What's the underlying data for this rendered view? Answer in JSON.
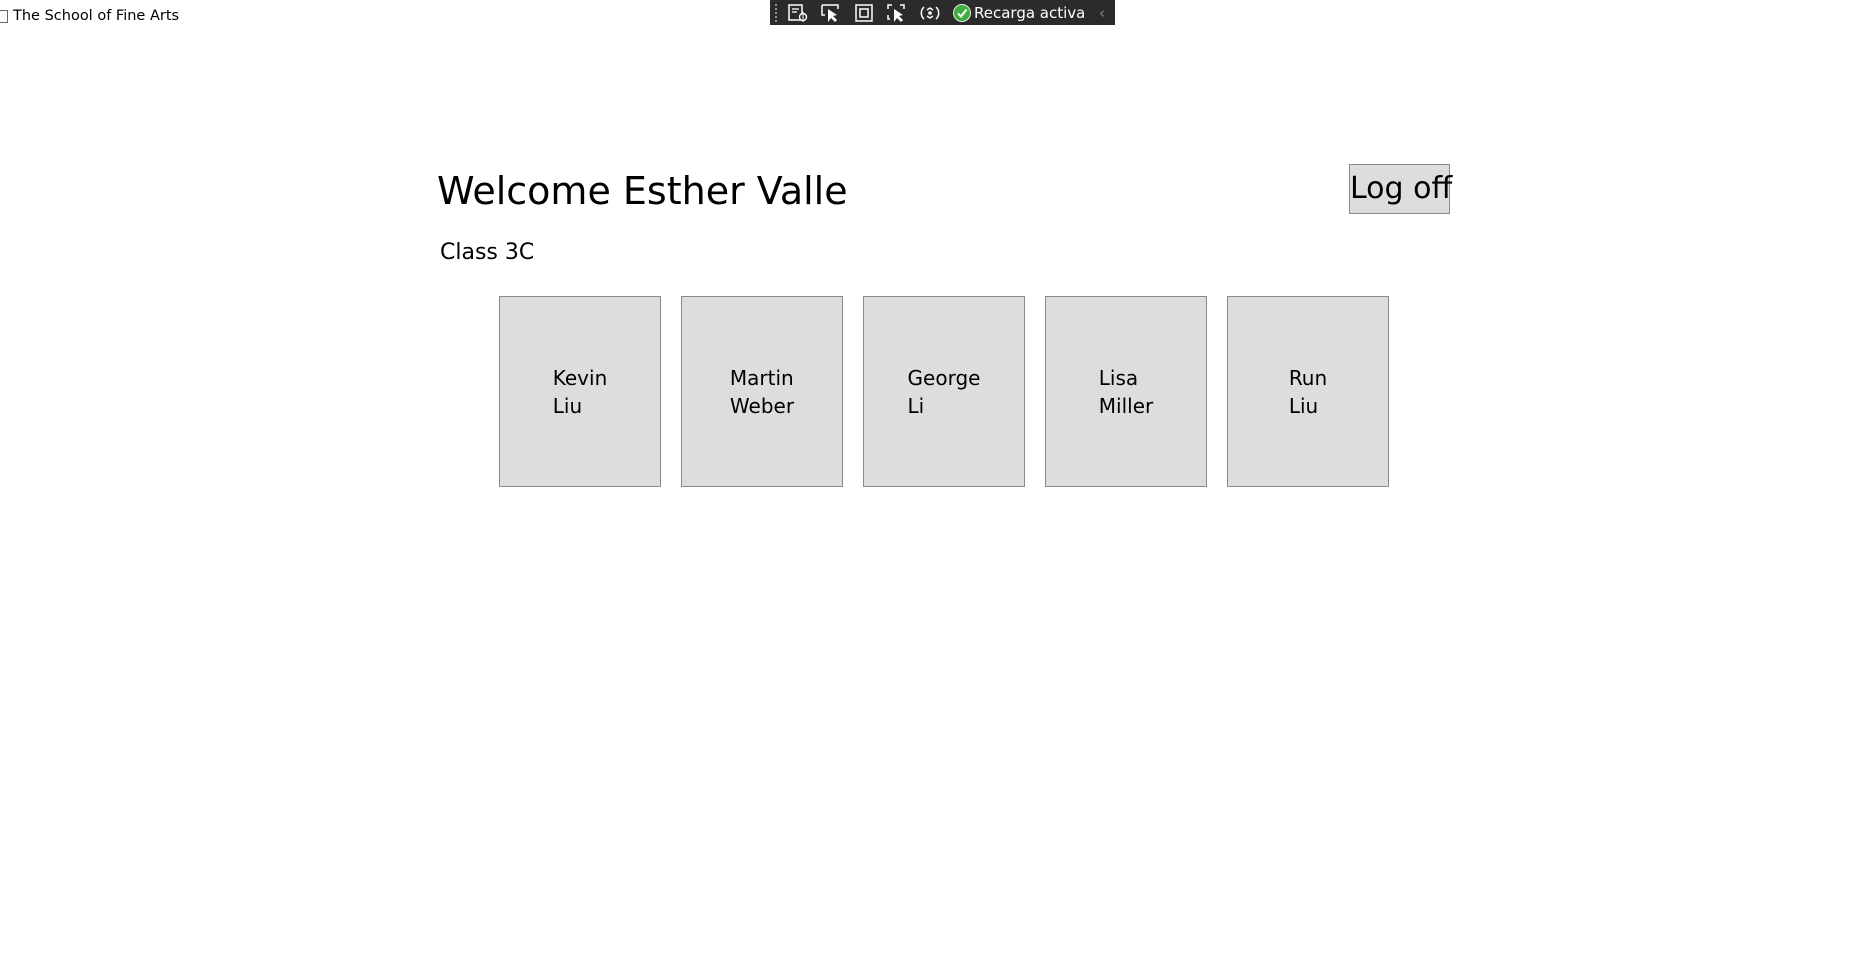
{
  "window": {
    "title": "The School of Fine Arts"
  },
  "devbar": {
    "tools": [
      "live-visual-tree-icon",
      "select-element-icon",
      "display-layout-adorners-icon",
      "track-focus-icon",
      "hot-reload-icon"
    ],
    "status_label": "Recarga activa",
    "status_color": "#3fae3f"
  },
  "header": {
    "welcome": "Welcome Esther Valle",
    "logoff_label": "Log off"
  },
  "class_label": "Class 3C",
  "students": [
    {
      "first": "Kevin",
      "last": "Liu"
    },
    {
      "first": "Martin",
      "last": "Weber"
    },
    {
      "first": "George",
      "last": "Li"
    },
    {
      "first": "Lisa",
      "last": "Miller"
    },
    {
      "first": "Run",
      "last": "Liu"
    }
  ]
}
